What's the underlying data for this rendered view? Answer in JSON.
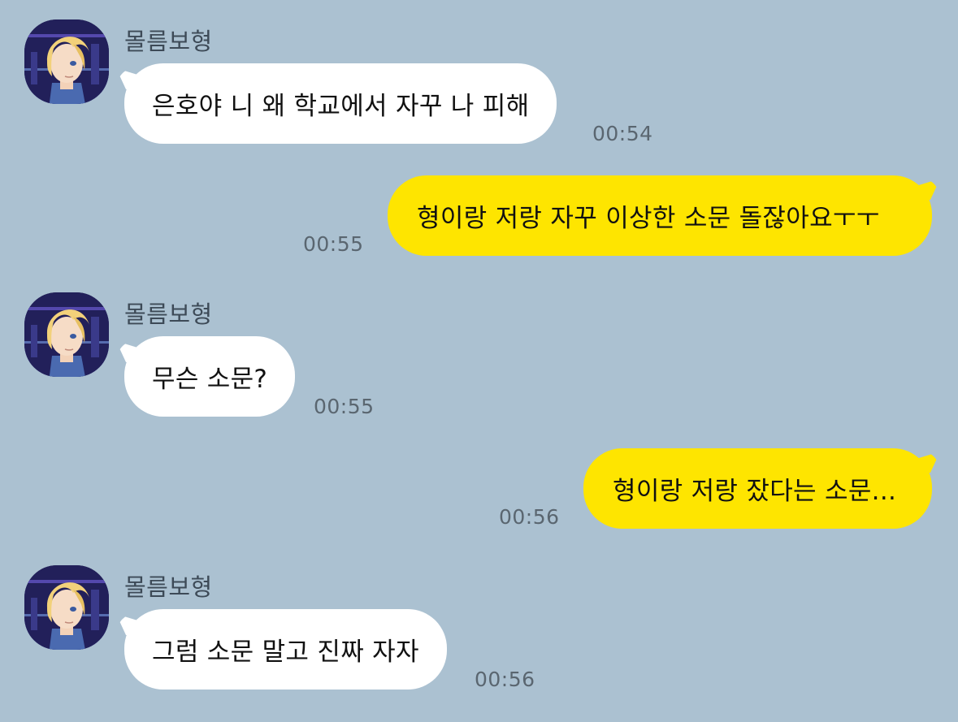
{
  "theme": {
    "background": "#abc1d1",
    "incoming_bubble": "#ffffff",
    "outgoing_bubble": "#fee500"
  },
  "messages": [
    {
      "direction": "incoming",
      "sender": "몰름보형",
      "text": "은호야 니 왜 학교에서 자꾸 나 피해",
      "time": "00:54",
      "avatar_icon": "anime-avatar-icon"
    },
    {
      "direction": "outgoing",
      "text": "형이랑 저랑 자꾸 이상한 소문 돌잖아요ㅜㅜ",
      "time": "00:55"
    },
    {
      "direction": "incoming",
      "sender": "몰름보형",
      "text": "무슨 소문?",
      "time": "00:55",
      "avatar_icon": "anime-avatar-icon"
    },
    {
      "direction": "outgoing",
      "text": "형이랑 저랑 잤다는 소문...",
      "time": "00:56"
    },
    {
      "direction": "incoming",
      "sender": "몰름보형",
      "text": "그럼 소문 말고 진짜 자자",
      "time": "00:56",
      "avatar_icon": "anime-avatar-icon"
    }
  ]
}
